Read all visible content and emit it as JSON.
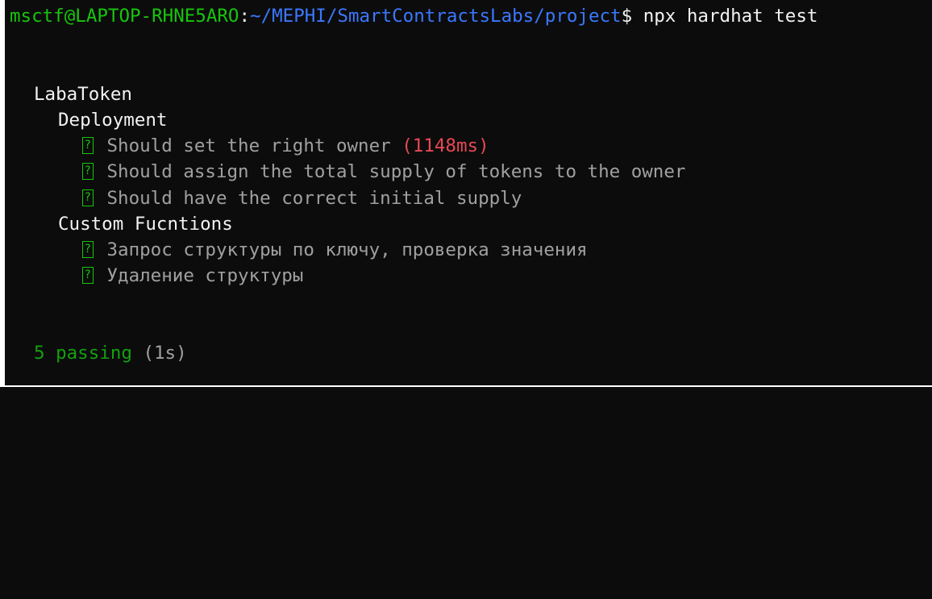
{
  "prompt": {
    "user_host": "msctf@LAPTOP-RHNE5ARO",
    "separator": ":",
    "path": "~/MEPHI/SmartContractsLabs/project",
    "symbol": "$",
    "command": " npx hardhat test"
  },
  "suite": {
    "title": "LabaToken",
    "groups": [
      {
        "title": "Deployment",
        "tests": [
          {
            "label": "Should set the right owner",
            "duration": "(1148ms)"
          },
          {
            "label": "Should assign the total supply of tokens to the owner",
            "duration": ""
          },
          {
            "label": "Should have the correct initial supply",
            "duration": ""
          }
        ]
      },
      {
        "title": "Custom Fucntions",
        "tests": [
          {
            "label": "Запрос структуры по ключу, проверка значения",
            "duration": ""
          },
          {
            "label": "Удаление структуры",
            "duration": ""
          }
        ]
      }
    ]
  },
  "summary": {
    "count_label": "5 passing",
    "time": "(1s)"
  },
  "colors": {
    "background": "#0c0c0c",
    "prompt_user": "#16c60c",
    "prompt_path": "#3b78ff",
    "pass": "#16c60c",
    "slow": "#e74856"
  },
  "icons": {
    "test_status": "check-icon"
  }
}
